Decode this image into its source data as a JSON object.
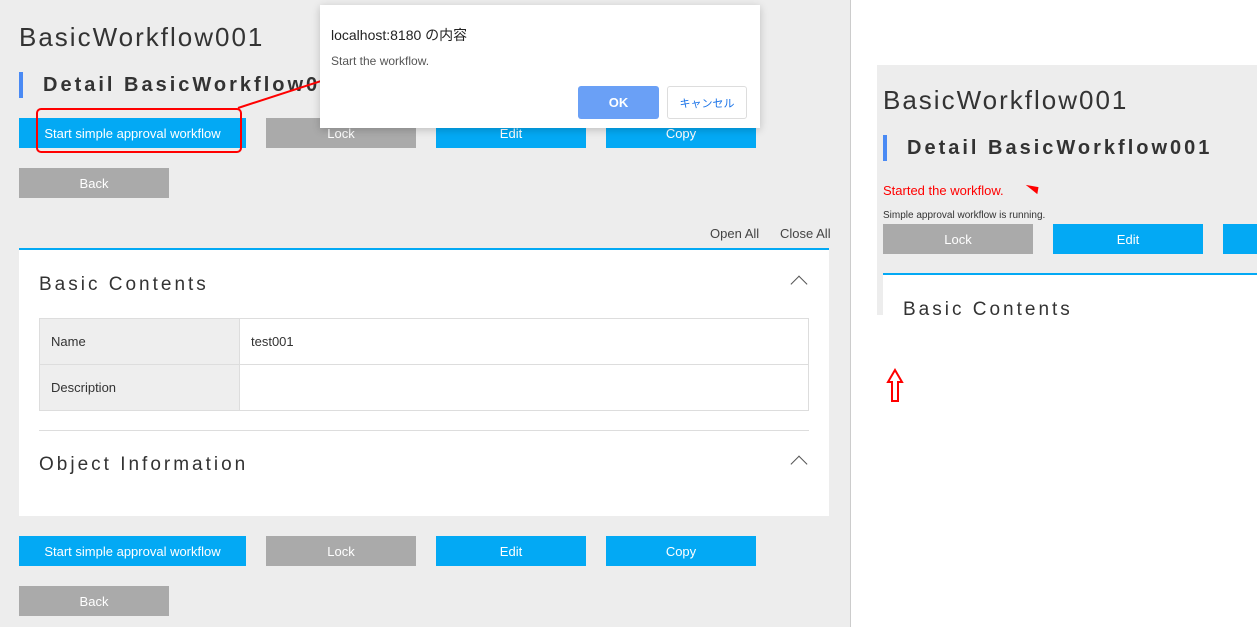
{
  "page": {
    "title": "BasicWorkflow001",
    "detail_title": "Detail BasicWorkflow001"
  },
  "buttons": {
    "start": "Start simple approval workflow",
    "lock": "Lock",
    "edit": "Edit",
    "copy": "Copy",
    "back": "Back"
  },
  "links": {
    "open_all": "Open All",
    "close_all": "Close All"
  },
  "sections": {
    "basic": "Basic Contents",
    "object": "Object Information"
  },
  "fields": [
    {
      "label": "Name",
      "value": "test001"
    },
    {
      "label": "Description",
      "value": ""
    }
  ],
  "dialog": {
    "title": "localhost:8180 の内容",
    "message": "Start the workflow.",
    "ok": "OK",
    "cancel": "キャンセル"
  },
  "result": {
    "message": "Started the workflow.",
    "status": "Simple approval workflow is running."
  },
  "colors": {
    "accent": "#03a9f4",
    "annotation": "#ff0000",
    "ok_button": "#6aa0f6"
  }
}
